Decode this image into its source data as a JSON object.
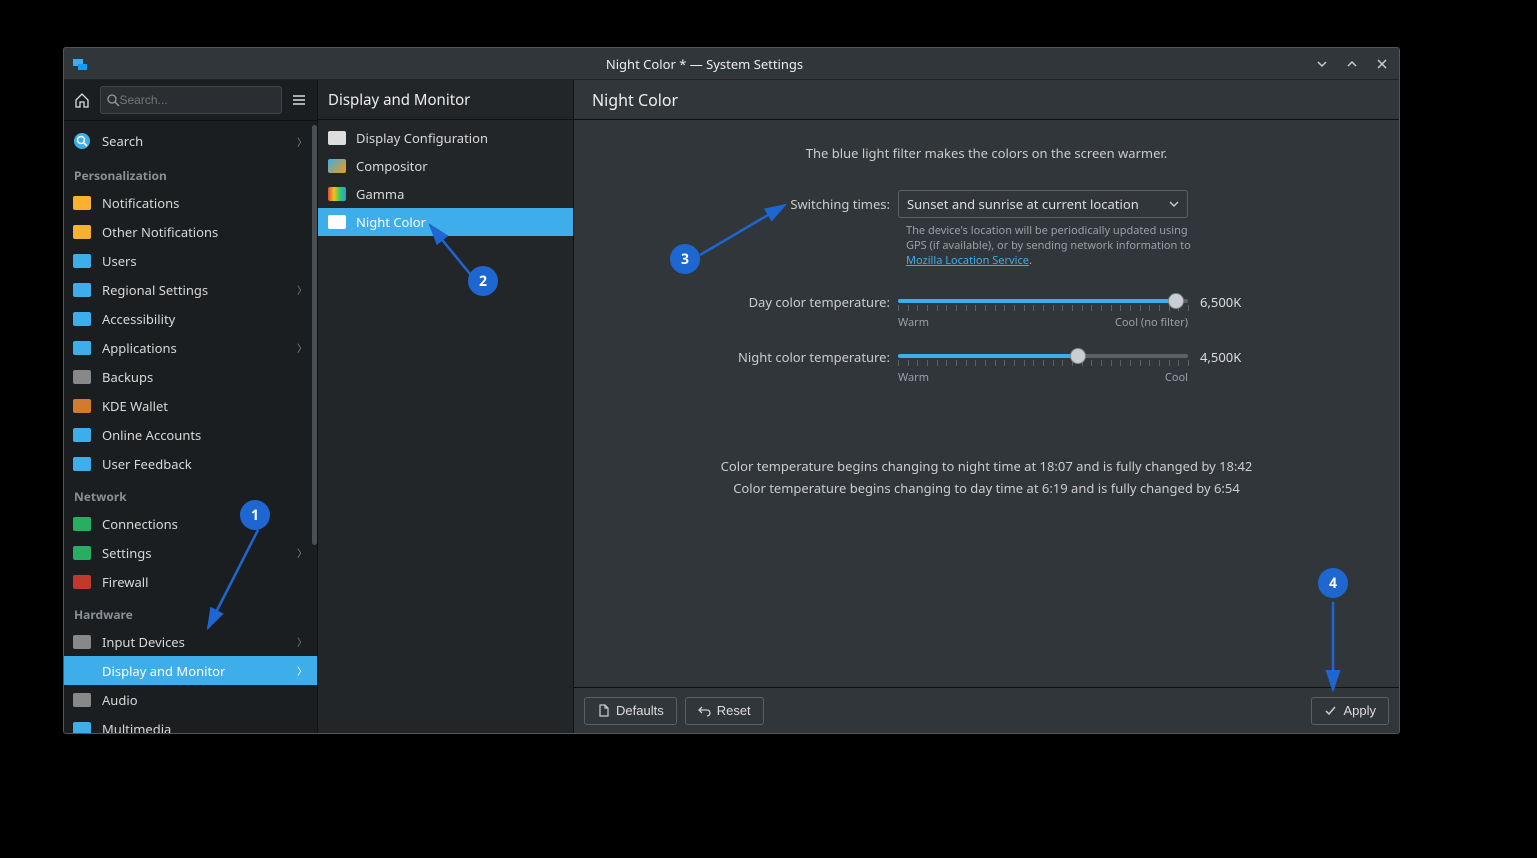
{
  "window": {
    "title": "Night Color * — System Settings"
  },
  "sidebar": {
    "search_placeholder": "Search...",
    "topitem": {
      "label": "Search"
    },
    "groups": [
      {
        "name": "Personalization",
        "items": [
          {
            "label": "Notifications",
            "icon": "bell-icon",
            "color": "#f9b12f"
          },
          {
            "label": "Other Notifications",
            "icon": "bell-icon",
            "color": "#f9b12f"
          },
          {
            "label": "Users",
            "icon": "user-icon",
            "color": "#3daee9"
          },
          {
            "label": "Regional Settings",
            "icon": "flag-icon",
            "color": "#3daee9",
            "chevron": true
          },
          {
            "label": "Accessibility",
            "icon": "accessibility-icon",
            "color": "#3daee9"
          },
          {
            "label": "Applications",
            "icon": "grid-icon",
            "color": "#3daee9",
            "chevron": true
          },
          {
            "label": "Backups",
            "icon": "safe-icon",
            "color": "#888888"
          },
          {
            "label": "KDE Wallet",
            "icon": "wallet-icon",
            "color": "#d07b2e"
          },
          {
            "label": "Online Accounts",
            "icon": "cloud-icon",
            "color": "#3daee9"
          },
          {
            "label": "User Feedback",
            "icon": "chat-icon",
            "color": "#3daee9"
          }
        ]
      },
      {
        "name": "Network",
        "items": [
          {
            "label": "Connections",
            "icon": "globe-icon",
            "color": "#27ae60"
          },
          {
            "label": "Settings",
            "icon": "globe-icon",
            "color": "#27ae60",
            "chevron": true
          },
          {
            "label": "Firewall",
            "icon": "firewall-icon",
            "color": "#c0392b"
          }
        ]
      },
      {
        "name": "Hardware",
        "items": [
          {
            "label": "Input Devices",
            "icon": "mouse-icon",
            "color": "#888888",
            "chevron": true
          },
          {
            "label": "Display and Monitor",
            "icon": "monitor-icon",
            "color": "#3daee9",
            "chevron": true,
            "active": true
          },
          {
            "label": "Audio",
            "icon": "speaker-icon",
            "color": "#888888"
          },
          {
            "label": "Multimedia",
            "icon": "monitor-icon",
            "color": "#3daee9"
          }
        ]
      }
    ]
  },
  "midcol": {
    "header": "Display and Monitor",
    "items": [
      {
        "label": "Display Configuration",
        "icon": "monitor-icon",
        "color": "#dddddd"
      },
      {
        "label": "Compositor",
        "icon": "compositor-icon",
        "gradient": true
      },
      {
        "label": "Gamma",
        "icon": "gamma-icon",
        "rainbow": true
      },
      {
        "label": "Night Color",
        "icon": "monitor-icon",
        "color": "#ffffff",
        "active": true
      }
    ]
  },
  "main": {
    "header": "Night Color",
    "intro": "The blue light filter makes the colors on the screen warmer.",
    "switching_label": "Switching times:",
    "switching_value": "Sunset and sunrise at current location",
    "hint_pre": "The device's location will be periodically updated using GPS (if available), or by sending network information to ",
    "hint_link": "Mozilla Location Service",
    "hint_post": ".",
    "day_label": "Day color temperature:",
    "day_value": "6,500K",
    "day_warm": "Warm",
    "day_cool": "Cool (no filter)",
    "night_label": "Night color temperature:",
    "night_value": "4,500K",
    "night_warm": "Warm",
    "night_cool": "Cool",
    "sched1": "Color temperature begins changing to night time at 18:07 and is fully changed by 18:42",
    "sched2": "Color temperature begins changing to day time at 6:19 and is fully changed by 6:54",
    "defaults_btn": "Defaults",
    "reset_btn": "Reset",
    "apply_btn": "Apply"
  },
  "annotations": {
    "n1": "1",
    "n2": "2",
    "n3": "3",
    "n4": "4"
  }
}
